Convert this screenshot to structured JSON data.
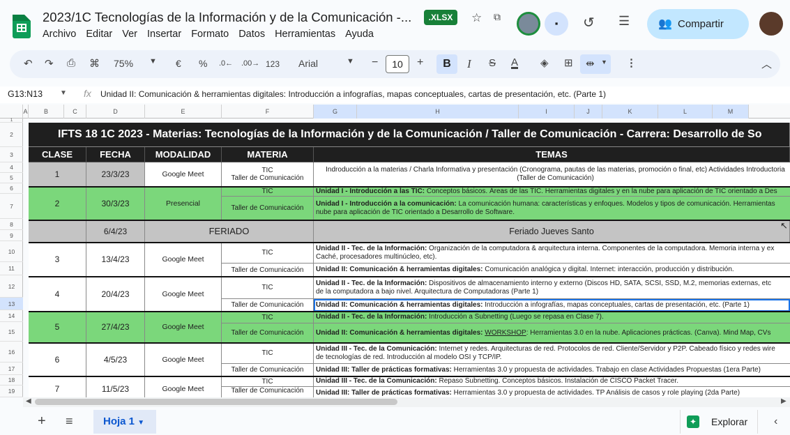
{
  "app": {
    "doc_title": "2023/1C Tecnologías de la Información y de la Comunicación -...",
    "badge": ".XLSX",
    "share_label": "Compartir",
    "menus": [
      "Archivo",
      "Editar",
      "Ver",
      "Insertar",
      "Formato",
      "Datos",
      "Herramientas",
      "Ayuda"
    ]
  },
  "toolbar": {
    "zoom": "75%",
    "currency": "€",
    "percent": "%",
    "dec_decrease": ".0←",
    "dec_increase": ".00→",
    "number_format": "123",
    "font": "Arial",
    "font_size": "10",
    "bold": "B",
    "italic": "I",
    "strike": "S",
    "text_color": "A"
  },
  "formula_bar": {
    "name_box": "G13:N13",
    "fx": "fx",
    "content": "Unidad II: Comunicación & herramientas digitales: Introducción a infografías, mapas conceptuales, cartas de presentación, etc. (Parte 1)"
  },
  "columns": [
    "A",
    "B",
    "C",
    "D",
    "E",
    "F",
    "G",
    "H",
    "I",
    "J",
    "K",
    "L",
    "M"
  ],
  "rows": [
    "1",
    "2",
    "3",
    "4",
    "5",
    "6",
    "7",
    "8",
    "9",
    "10",
    "11",
    "12",
    "13",
    "14",
    "15",
    "16",
    "17",
    "18",
    "19"
  ],
  "sheet": {
    "banner": "IFTS 18 1C 2023 - Materias: Tecnologías de la Información y de la Comunicación / Taller de Comunicación - Carrera: Desarrollo de So",
    "headers": {
      "clase": "CLASE",
      "fecha": "FECHA",
      "modalidad": "MODALIDAD",
      "materia": "MATERIA",
      "temas": "TEMAS"
    },
    "r1": {
      "clase": "1",
      "fecha": "23/3/23",
      "modalidad": "Google Meet",
      "m1": "TIC",
      "m2": "Taller de Comunicación",
      "t1": "Indroducción a la materias / Charla Informativa y presentación (Cronograma, pautas de las materias, promoción o final, etc) Actividades Introductoria",
      "t2": "(Taller de Comunicación)"
    },
    "r2": {
      "clase": "2",
      "fecha": "30/3/23",
      "modalidad": "Presencial",
      "m1": "TIC",
      "m2": "Taller de Comunicación",
      "t1b": "Unidad I - Introducción a las TIC:",
      "t1": " Conceptos básicos. Áreas de las TIC. Herramientas digitales y en la nube para aplicación de TIC orientado a Des",
      "t2b": "Unidad I - Introducción a la comunicación:",
      "t2": " La comunicación humana: características y enfoques. Modelos y tipos de comunicación. Herramientas",
      "t3": "nube para aplicación de TIC orientado a Desarrollo de Software."
    },
    "feriado": {
      "fecha": "6/4/23",
      "label": "FERIADO",
      "tema": "Feriado Jueves Santo"
    },
    "r3": {
      "clase": "3",
      "fecha": "13/4/23",
      "modalidad": "Google Meet",
      "m1": "TIC",
      "m2": "Taller de Comunicación",
      "t1b": "Unidad II - Tec. de la Información:",
      "t1": " Organización de la computadora & arquitectura interna. Componentes de la computadora. Memoria interna y ex",
      "t1c": "Caché, procesadores multinúcleo, etc).",
      "t2b": "Unidad II: Comunicación & herramientas digitales:",
      "t2": " Comunicación analógica y digital. Internet: interacción, producción y distribución."
    },
    "r4": {
      "clase": "4",
      "fecha": "20/4/23",
      "modalidad": "Google Meet",
      "m1": "TIC",
      "m2": "Taller de Comunicación",
      "t1b": "Unidad II - Tec. de la Información:",
      "t1": " Dispositivos de almacenamiento interno y externo (Discos HD, SATA, SCSI, SSD, M.2, memorias externas, etc",
      "t1c": "de la computadora a bajo nivel. Arquitectura de Computadoras (Parte 1)",
      "t2b": "Unidad II: Comunicación & herramientas digitales:",
      "t2": " Introducción a infografías, mapas conceptuales, cartas de presentación, etc. (Parte 1)"
    },
    "r5": {
      "clase": "5",
      "fecha": "27/4/23",
      "modalidad": "Google Meet",
      "m1": "TIC",
      "m2": "Taller de Comunicación",
      "t1b": "Unidad II - Tec. de la Información:",
      "t1": " Introducción a Subnetting (Luego se repasa en Clase 7).",
      "t2b": "Unidad II: Comunicación & herramientas digitales:",
      "t2u": "WORKSHOP",
      "t2": ": Herramientas 3.0 en la nube. Aplicaciones prácticas. (Canva). Mind Map, CVs"
    },
    "r6": {
      "clase": "6",
      "fecha": "4/5/23",
      "modalidad": "Google Meet",
      "m1": "TIC",
      "m2": "Taller de Comunicación",
      "t1b": "Unidad III - Tec. de la Comunicación:",
      "t1": " Internet y redes. Arquitecturas de red. Protocolos de red. Cliente/Servidor y P2P. Cabeado físico y redes wire",
      "t1c": "de tecnologías de red. Introducción al modelo OSI y TCP/IP.",
      "t2b": "Unidad III: Taller de prácticas formativas:",
      "t2": " Herramientas 3.0 y propuesta de actividades. Trabajo en clase Actividades Propuestas (1era Parte)"
    },
    "r7": {
      "clase": "7",
      "fecha": "11/5/23",
      "modalidad": "Google Meet",
      "m1": "TIC",
      "m2": "Taller de Comunicación",
      "t1b": "Unidad III - Tec. de la Comunicación:",
      "t1": " Repaso Subnetting. Conceptos básicos. Instalación de CISCO Packet Tracer.",
      "t2b": "Unidad III: Taller de prácticas formativas:",
      "t2": " Herramientas 3.0 y propuesta de actividades. TP Análisis de casos y role playing (2da Parte)"
    }
  },
  "bottom": {
    "add": "+",
    "list": "≡",
    "tab": "Hoja 1",
    "explore": "Explorar"
  }
}
